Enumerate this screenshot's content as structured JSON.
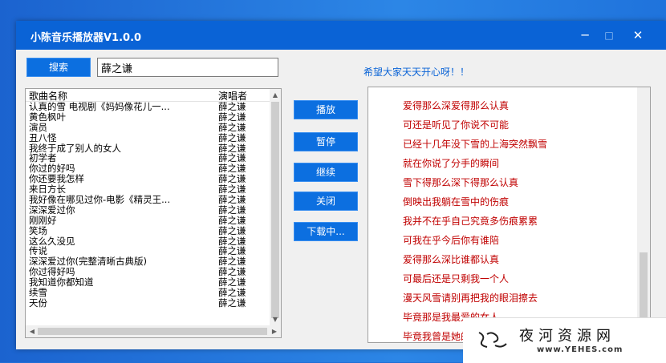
{
  "window": {
    "title": "小陈音乐播放器V1.0.0",
    "minimize_glyph": "─",
    "maximize_glyph": "□",
    "close_glyph": "✕"
  },
  "search": {
    "button_label": "搜索",
    "value": "薛之谦"
  },
  "song_list": {
    "columns": [
      "歌曲名称",
      "演唱者"
    ],
    "rows": [
      {
        "name": "认真的雪 电视剧《妈妈像花儿一...",
        "artist": "薛之谦"
      },
      {
        "name": "黄色枫叶",
        "artist": "薛之谦"
      },
      {
        "name": "演员",
        "artist": "薛之谦"
      },
      {
        "name": "丑八怪",
        "artist": "薛之谦"
      },
      {
        "name": "我终于成了别人的女人",
        "artist": "薛之谦"
      },
      {
        "name": "初学者",
        "artist": "薛之谦"
      },
      {
        "name": "你过的好吗",
        "artist": "薛之谦"
      },
      {
        "name": "你还要我怎样",
        "artist": "薛之谦"
      },
      {
        "name": "来日方长",
        "artist": "薛之谦"
      },
      {
        "name": "我好像在哪见过你-电影《精灵王...",
        "artist": "薛之谦"
      },
      {
        "name": "深深爱过你",
        "artist": "薛之谦"
      },
      {
        "name": "刚刚好",
        "artist": "薛之谦"
      },
      {
        "name": "笑场",
        "artist": "薛之谦"
      },
      {
        "name": "这么久没见",
        "artist": "薛之谦"
      },
      {
        "name": "传说",
        "artist": "薛之谦"
      },
      {
        "name": "深深爱过你(完整清晰古典版)",
        "artist": "薛之谦"
      },
      {
        "name": "你过得好吗",
        "artist": "薛之谦"
      },
      {
        "name": "我知道你都知道",
        "artist": "薛之谦"
      },
      {
        "name": "续雪",
        "artist": "薛之谦"
      },
      {
        "name": "天份",
        "artist": "薛之谦"
      }
    ]
  },
  "controls": {
    "play": "播放",
    "pause": "暂停",
    "resume": "继续",
    "close": "关闭",
    "download": "下载中..."
  },
  "notice": "希望大家天天开心呀！！",
  "lyrics": [
    "爱得那么深爱得那么认真",
    "可还是听见了你说不可能",
    "已经十几年没下雪的上海突然飘雪",
    "就在你说了分手的瞬间",
    "雪下得那么深下得那么认真",
    "倒映出我躺在雪中的伤痕",
    "我并不在乎自己究竟多伤痕累累",
    "可我在乎今后你有谁陪",
    "爱得那么深比谁都认真",
    "可最后还是只剩我一个人",
    "漫天风雪请别再把我的眼泪擦去",
    "毕竟那是我最爱的女人",
    "毕竟我曾是她的男人"
  ],
  "watermark": {
    "chinese": "夜河资源网",
    "url": "www.YEHES.com",
    "icon": "ornament-icon"
  },
  "colors": {
    "accent": "#0c6fe0",
    "title_bar": "#0a63d6",
    "lyric_text": "#c00000",
    "notice_text": "#0a63d6"
  }
}
